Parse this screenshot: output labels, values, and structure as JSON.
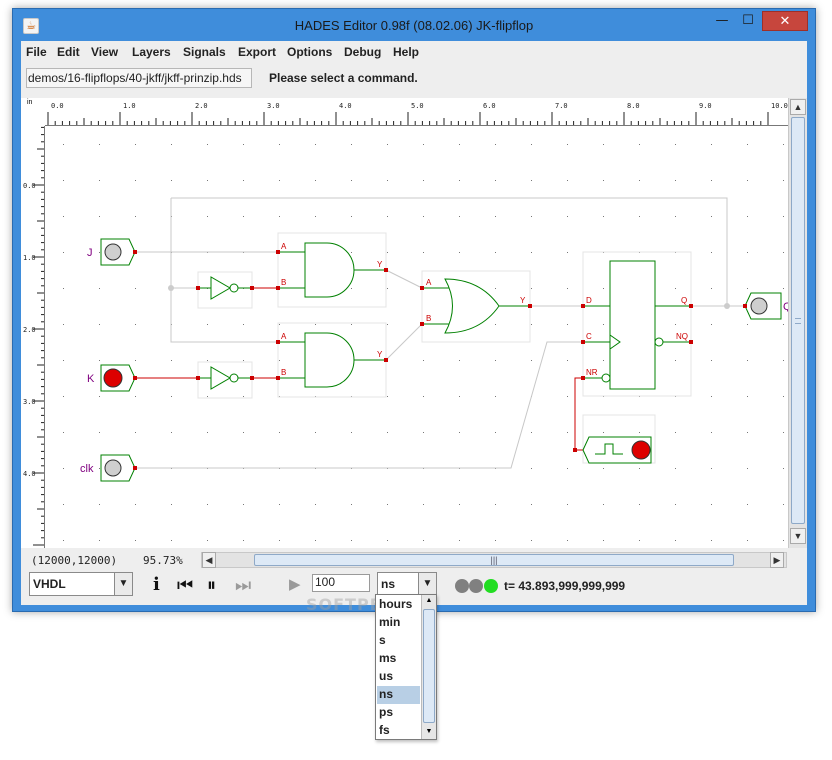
{
  "window": {
    "title": "HADES Editor 0.98f (08.02.06)   JK-flipflop",
    "app_icon": "coffee-cup-icon",
    "min_glyph": "—",
    "max_glyph": "☐",
    "close_glyph": "✕"
  },
  "menu": [
    "File",
    "Edit",
    "View",
    "Layers",
    "Signals",
    "Export",
    "Options",
    "Debug",
    "Help"
  ],
  "toolbar": {
    "path": "demos/16-flipflops/40-jkff/jkff-prinzip.hds",
    "message": "Please select a command."
  },
  "ruler": {
    "unit": "in",
    "h_labels": [
      "0.0",
      "1.0",
      "2.0",
      "3.0",
      "4.0",
      "5.0",
      "6.0",
      "7.0",
      "8.0",
      "9.0",
      "10.0"
    ],
    "v_labels": [
      "0.0",
      "1.0",
      "2.0",
      "3.0",
      "4.0"
    ]
  },
  "schematic": {
    "inputs": [
      "J",
      "K",
      "clk"
    ],
    "output": "Q",
    "and_ports": [
      "A",
      "B",
      "Y"
    ],
    "or_ports": [
      "A",
      "B",
      "Y"
    ],
    "ff_ports": [
      "D",
      "C",
      "NR",
      "Q",
      "NQ"
    ],
    "wire_color": "#c8c8c8",
    "active_wire_color": "#cc0000",
    "gate_color": "#008000",
    "label_color": "#800080"
  },
  "status": {
    "coords": "(12000,12000)",
    "zoom": "95.73%"
  },
  "bottom": {
    "language": "VHDL",
    "steps": "100",
    "unit": "ns",
    "time": "t= 43.893,999,999,999",
    "info_icon": "info-icon",
    "rewind_icon": "rewind-icon",
    "pause_icon": "pause-icon",
    "fast_forward_icon": "fast-forward-icon",
    "play_icon": "play-icon",
    "led_colors": [
      "#808080",
      "#808080",
      "#22dd22"
    ]
  },
  "time_units": {
    "options": [
      "hours",
      "min",
      "s",
      "ms",
      "us",
      "ns",
      "ps",
      "fs"
    ],
    "selected": "ns"
  },
  "watermark": "SOFTPEDIA"
}
